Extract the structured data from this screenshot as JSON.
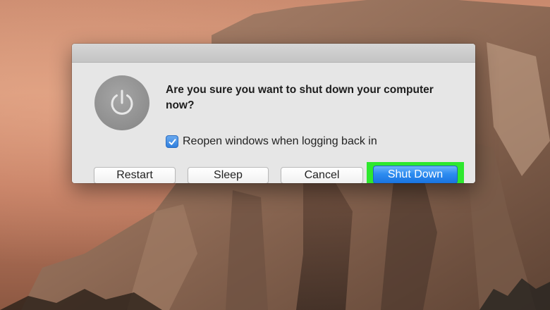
{
  "dialog": {
    "message": "Are you sure you want to shut down your computer now?",
    "reopen_label": "Reopen windows when logging back in",
    "reopen_checked": true,
    "icon": "power-icon"
  },
  "buttons": {
    "restart": "Restart",
    "sleep": "Sleep",
    "cancel": "Cancel",
    "shut_down": "Shut Down"
  },
  "colors": {
    "accent_button": "#2d8cf0",
    "highlight": "#2ee82e",
    "checkbox": "#2f7fde"
  }
}
